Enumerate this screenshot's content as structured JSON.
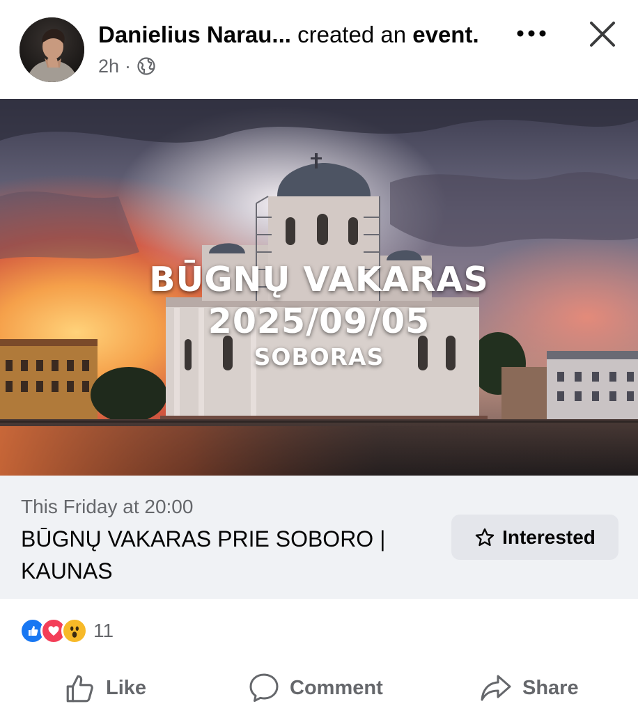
{
  "post": {
    "author": "Danielius Narau...",
    "verb": "created an",
    "object": "event.",
    "time": "2h",
    "separator": "·",
    "privacy_icon": "globe-icon"
  },
  "cover": {
    "line1": "BŪGNŲ VAKARAS",
    "line2": "2025/09/05",
    "line3": "SOBORAS"
  },
  "event": {
    "when": "This Friday at 20:00",
    "title": "BŪGNŲ VAKARAS PRIE SOBORO | KAUNAS",
    "interested_label": "Interested"
  },
  "reactions": {
    "icons": [
      "like-icon",
      "love-icon",
      "wow-icon"
    ],
    "count": "11"
  },
  "actions": {
    "like": "Like",
    "comment": "Comment",
    "share": "Share"
  },
  "colors": {
    "primary": "#1877f2",
    "secondary_text": "#65676b",
    "event_bg": "#f0f2f5",
    "button_bg": "#e4e6eb"
  }
}
